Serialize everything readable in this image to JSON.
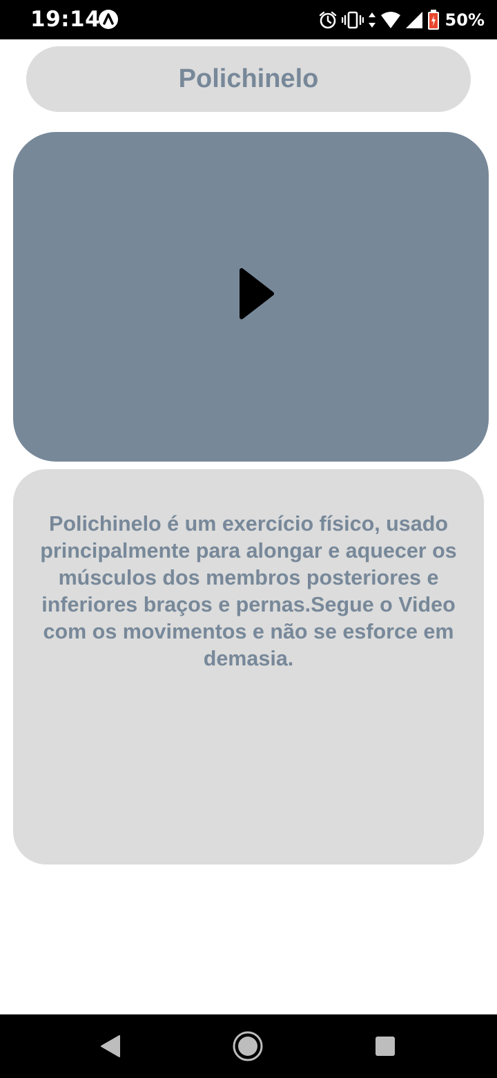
{
  "status_bar": {
    "time": "19:14",
    "battery_percent": "50%",
    "icons": [
      "app-notification-icon",
      "alarm-icon",
      "vibrate-icon",
      "data-arrows-icon",
      "wifi-icon",
      "cell-signal-icon",
      "battery-icon"
    ],
    "battery_color": "#e8472f"
  },
  "header": {
    "title": "Polichinelo"
  },
  "video": {
    "play_icon": "play-icon",
    "background_color": "#778899"
  },
  "description": {
    "text": "Polichinelo é um exercício físico, usado principalmente para alongar e aquecer os músculos dos membros posteriores e inferiores braços e pernas.Segue o Video com os movimentos e não se esforce em demasia."
  },
  "nav_bar": {
    "buttons": [
      "back-icon",
      "home-icon",
      "recents-icon"
    ]
  },
  "colors": {
    "accent_text": "#778899",
    "panel": "#dcdcdc"
  }
}
